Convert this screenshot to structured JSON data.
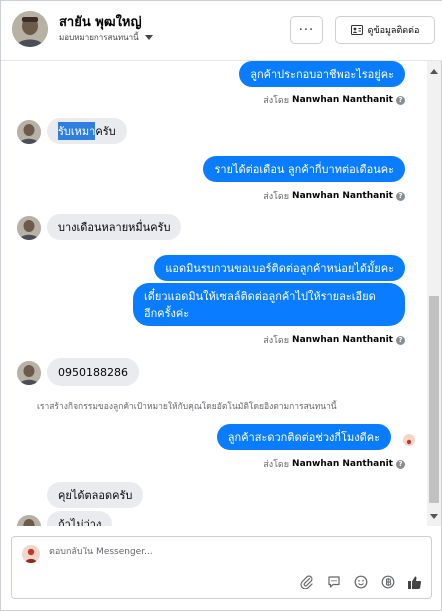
{
  "header": {
    "name": "สายัน พุฒใหญ่",
    "assignment": "มอบหมายการสนทนานี้",
    "more_label": "···",
    "contact_label": "ดูข้อมูลติดต่อ"
  },
  "messages": {
    "m1_out": "ลูกค้าประกอบอาชีพอะไรอยู่คะ",
    "m1_sent_prefix": "ส่งโดย",
    "m1_sent_name": "Nanwhan Nanthanit",
    "m2_in_highlight": "รับเหมา",
    "m2_in_rest": "ครับ",
    "m3_out": "รายได้ต่อเดือน ลูกค้ากี่บาทต่อเดือนคะ",
    "m3_sent_prefix": "ส่งโดย",
    "m3_sent_name": "Nanwhan Nanthanit",
    "m4_in": "บางเดือนหลายหมื่นครับ",
    "m5_out": "แอดมินรบกวนขอเบอร์ติดต่อลูกค้าหน่อยได้มั้ยคะ",
    "m6_out_line1": "เดี๋ยวแอดมินให้เซลล์ติดต่อลูกค้าไปให้รายละเอียด",
    "m6_out_line2": "อีกครั้งค่ะ",
    "m6_sent_prefix": "ส่งโดย",
    "m6_sent_name": "Nanwhan Nanthanit",
    "m7_in": "0950188286",
    "system_note": "เราสร้างกิจกรรมของลูกค้าเป้าหมายให้กับคุณโดยอัตโนมัติโดยอิงตามการสนทนานี้",
    "m8_out": "ลูกค้าสะดวกติดต่อช่วงกี่โมงดีคะ",
    "m8_sent_prefix": "ส่งโดย",
    "m8_sent_name": "Nanwhan Nanthanit",
    "m9_in": "คุยได้ตลอดครับ",
    "m10_in": "ถ้าไม่ว่าง"
  },
  "composer": {
    "placeholder": "ตอบกลับใน Messenger..."
  },
  "colors": {
    "outgoing": "#0a7cff",
    "incoming": "#e9ebef",
    "muted": "#65676b"
  },
  "icons": [
    "avatar",
    "caret-down-icon",
    "more-icon",
    "contact-card-icon",
    "help-icon",
    "paperclip-icon",
    "comment-icon",
    "emoji-icon",
    "baht-icon",
    "thumbs-up-icon"
  ]
}
